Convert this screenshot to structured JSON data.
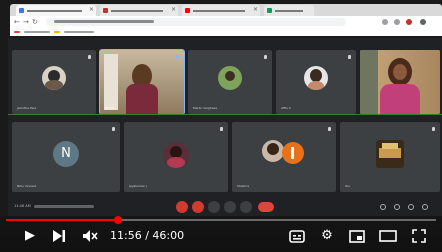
{
  "meeting": {
    "participants": [
      {
        "name": "Jacintha Paul"
      },
      {
        "name": "Nikhil"
      },
      {
        "name": "Merlin Varghese"
      },
      {
        "name": "Affin C"
      },
      {
        "name": ""
      },
      {
        "name": "Nibu Vincent",
        "initial": "N"
      },
      {
        "name": "Jayakumar J"
      },
      {
        "name": "Shalima"
      },
      {
        "name": "You"
      }
    ],
    "bottom_bar": {
      "time": "11:46 AM"
    },
    "colors": {
      "grid_background": "#202124",
      "tile_background": "#3c4043",
      "hangup_red": "#e0453b",
      "tile_divider_green": "#3a7a35"
    }
  },
  "player": {
    "progress_fraction": 0.26,
    "time": "11:56 / 46:00",
    "icons": [
      "play-icon",
      "next-icon",
      "mute-icon",
      "subtitles-icon",
      "settings-gear-icon",
      "miniplayer-icon",
      "theater-mode-icon",
      "fullscreen-icon"
    ],
    "accent_color": "#ff0000"
  },
  "browser": {
    "icons": [
      "back-arrow-icon",
      "forward-arrow-icon",
      "reload-icon"
    ]
  }
}
